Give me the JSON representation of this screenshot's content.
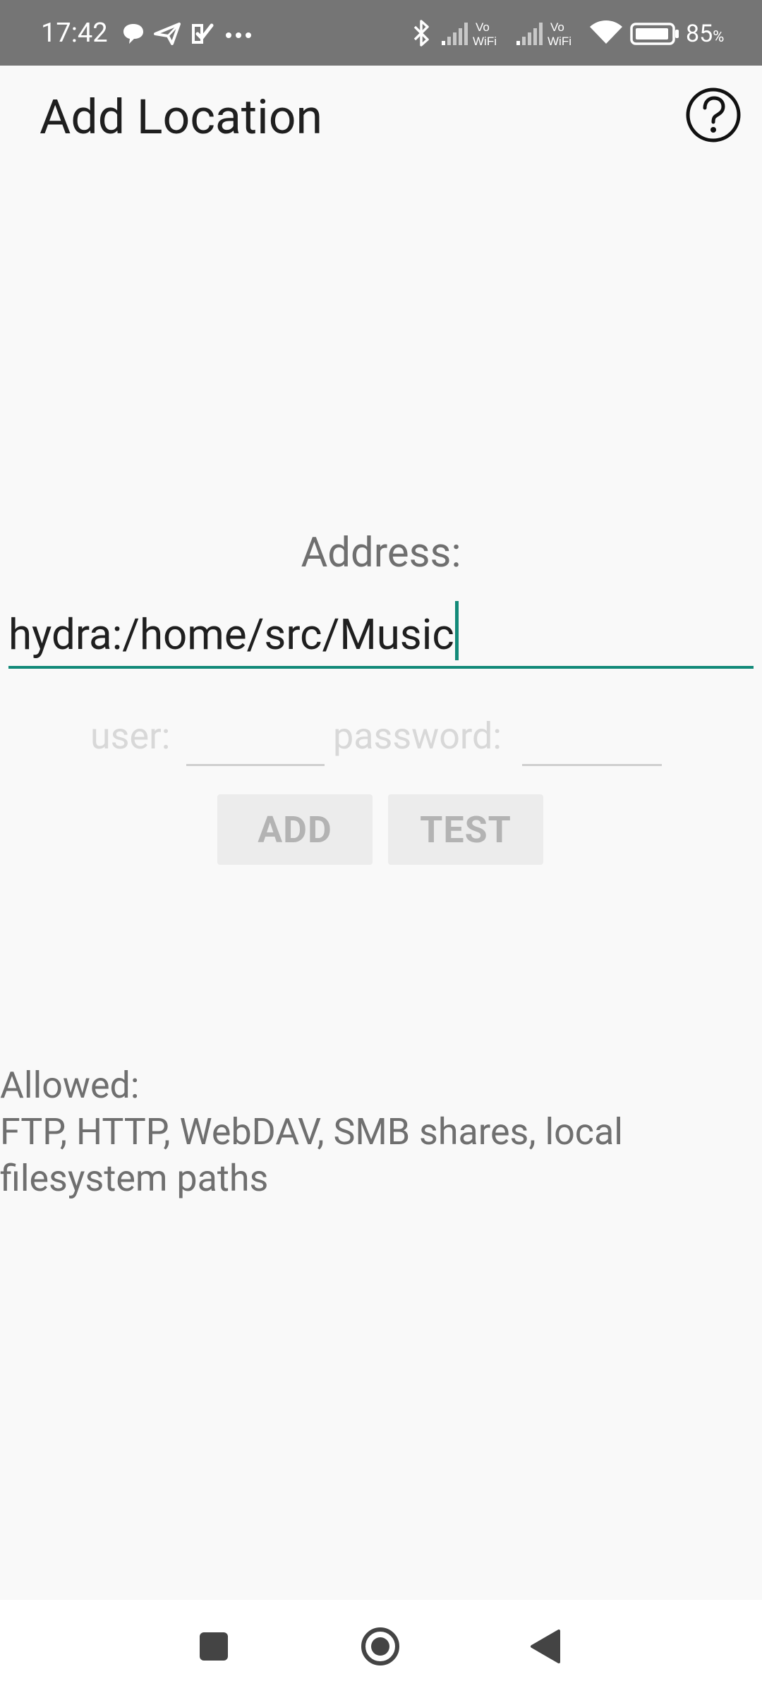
{
  "status_bar": {
    "time": "17:42",
    "battery_percent": "85",
    "battery_percent_sign": "%",
    "background_color": "#757575"
  },
  "app_bar": {
    "title": "Add Location",
    "help_icon": "question-circle-icon"
  },
  "address": {
    "label": "Address:",
    "value": "hydra:/home/src/Music",
    "accent_color": "#138a79"
  },
  "credentials": {
    "user_label": "user:",
    "user_value": "",
    "password_label": "password:",
    "password_value": ""
  },
  "buttons": {
    "add_label": "ADD",
    "test_label": "TEST"
  },
  "info": {
    "heading": "Allowed:",
    "text": "FTP, HTTP, WebDAV, SMB shares, local filesystem paths"
  },
  "nav_bar": {
    "recents_icon": "square-icon",
    "home_icon": "circle-icon",
    "back_icon": "triangle-back-icon"
  }
}
